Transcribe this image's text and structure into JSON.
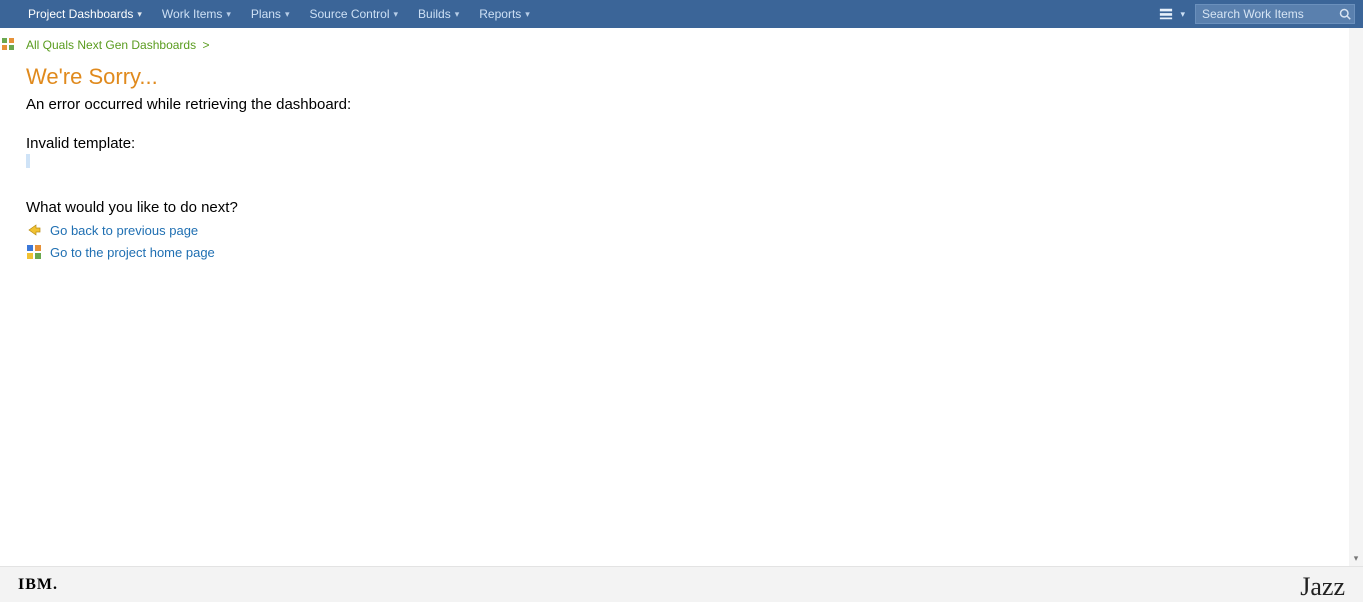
{
  "nav": {
    "items": [
      {
        "label": "Project Dashboards",
        "active": true
      },
      {
        "label": "Work Items",
        "active": false
      },
      {
        "label": "Plans",
        "active": false
      },
      {
        "label": "Source Control",
        "active": false
      },
      {
        "label": "Builds",
        "active": false
      },
      {
        "label": "Reports",
        "active": false
      }
    ]
  },
  "search": {
    "placeholder": "Search Work Items"
  },
  "breadcrumb": {
    "text": "All Quals Next Gen Dashboards",
    "sep": ">"
  },
  "error": {
    "title": "We're Sorry...",
    "occurred": "An error occurred while retrieving the dashboard:",
    "invalid": "Invalid template:",
    "next_question": "What would you like to do next?"
  },
  "actions": {
    "back": "Go back to previous page",
    "home": "Go to the project home page"
  },
  "footer": {
    "ibm": "IBM.",
    "jazz": "Jazz"
  }
}
